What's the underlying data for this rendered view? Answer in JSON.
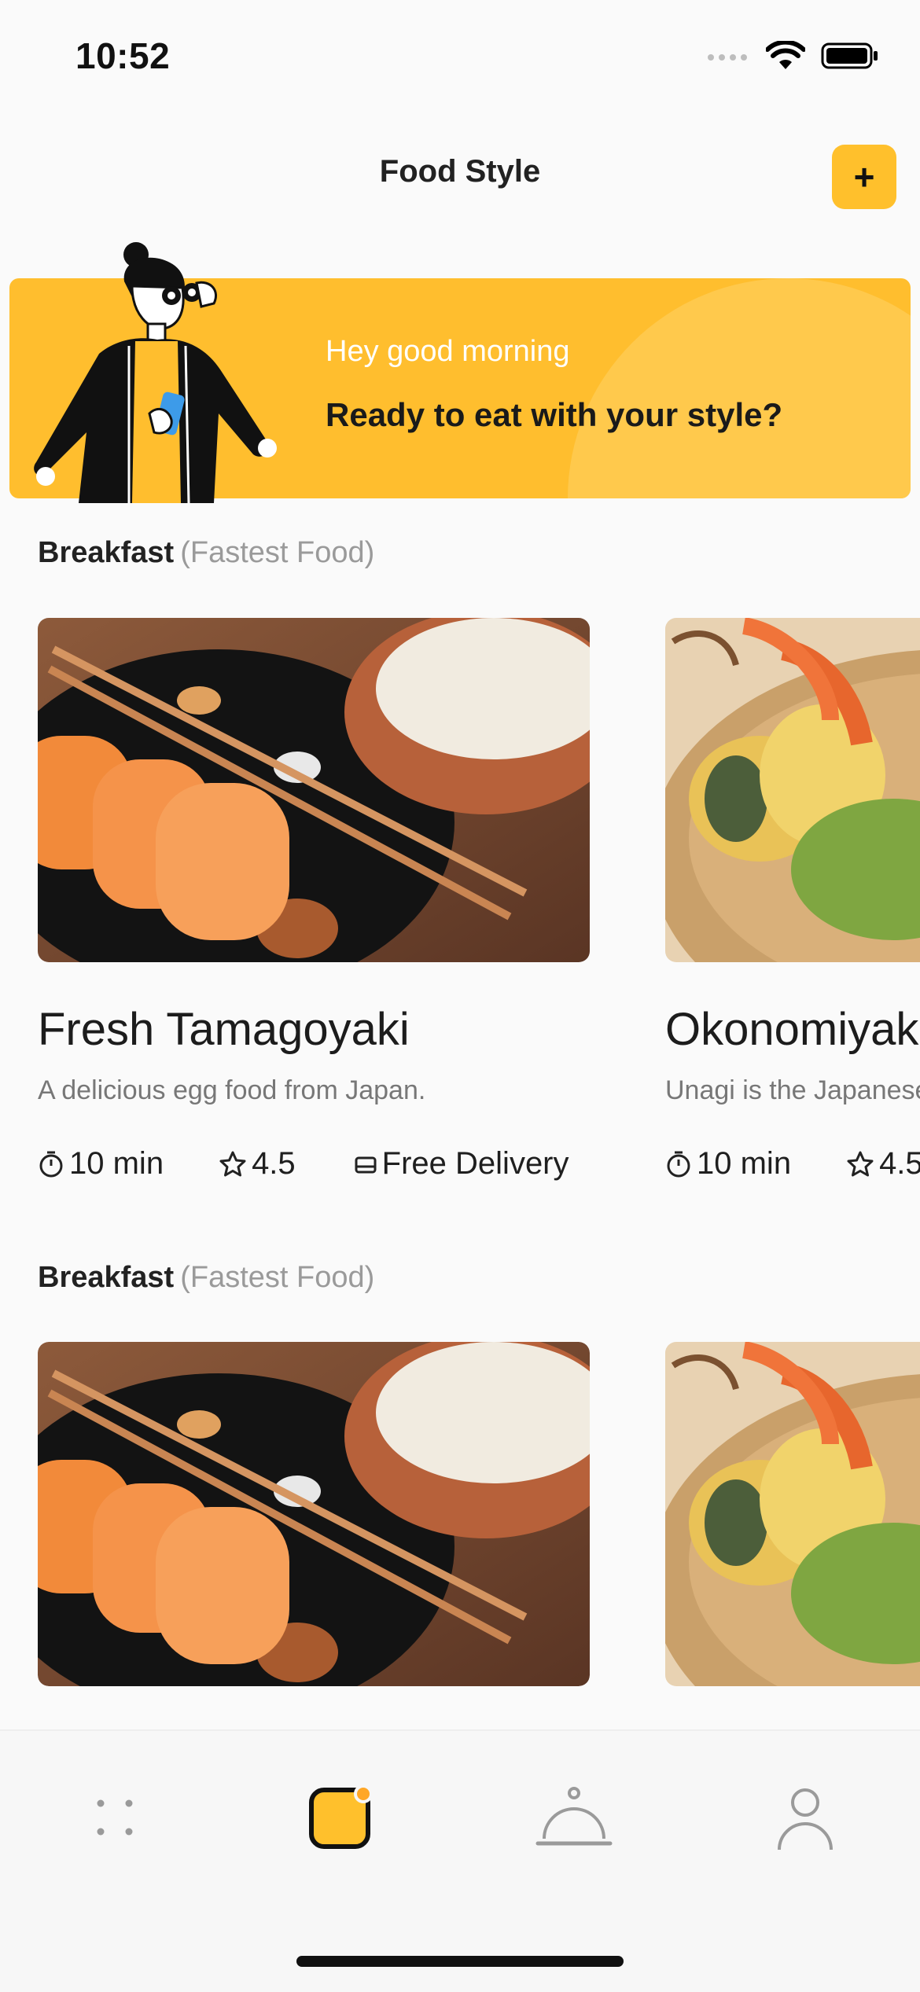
{
  "status_bar": {
    "time": "10:52"
  },
  "header": {
    "title": "Food Style",
    "add_label": "+"
  },
  "banner": {
    "greeting": "Hey good morning",
    "headline": "Ready to eat with your style?"
  },
  "sections": [
    {
      "title": "Breakfast",
      "subtitle": "(Fastest Food)",
      "cards": [
        {
          "name": "Fresh Tamagoyaki",
          "description": "A delicious egg food from Japan.",
          "time": "10 min",
          "rating": "4.5",
          "delivery": "Free Delivery"
        },
        {
          "name": "Okonomiyak",
          "description": "Unagi is the Japanese",
          "time": "10 min",
          "rating": "4.5"
        }
      ]
    },
    {
      "title": "Breakfast",
      "subtitle": "(Fastest Food)"
    }
  ],
  "tab_bar": {
    "items": [
      {
        "icon": "grid-dots-icon"
      },
      {
        "icon": "app-icon",
        "active": true
      },
      {
        "icon": "cloche-icon"
      },
      {
        "icon": "profile-icon"
      }
    ]
  },
  "colors": {
    "accent": "#FFC02C",
    "badge": "#FFA726"
  }
}
